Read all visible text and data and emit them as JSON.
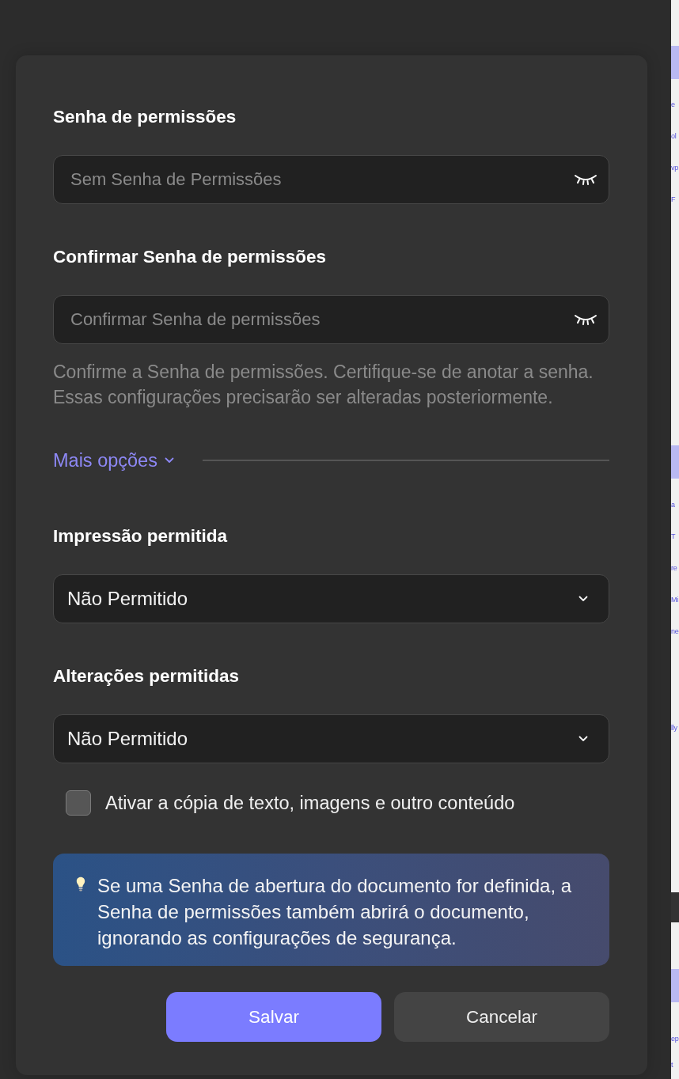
{
  "dialog": {
    "password_fields": [
      {
        "label": "Senha de permissões",
        "placeholder": "Sem Senha de Permissões",
        "masked": true
      },
      {
        "label": "Confirmar Senha de permissões",
        "placeholder": "Confirmar Senha de permissões",
        "masked": true
      }
    ],
    "hint": "Confirme a Senha de permissões. Certifique-se de anotar a senha. Essas configurações precisarão ser alteradas posteriormente.",
    "more_options": {
      "label": "Mais opções"
    },
    "dropdowns": [
      {
        "label": "Impressão permitida",
        "value": "Não Permitido"
      },
      {
        "label": "Alterações permitidas",
        "value": "Não Permitido"
      }
    ],
    "copy_option": {
      "label": "Ativar a cópia de texto, imagens e outro conteúdo",
      "checked": false
    },
    "info": "Se uma Senha de abertura do documento for definida, a Senha de permissões também abrirá o documento, ignorando as configurações de segurança.",
    "buttons": [
      {
        "label": "Salvar",
        "kind": "primary"
      },
      {
        "label": "Cancelar",
        "kind": "secondary"
      }
    ]
  },
  "background_page": {
    "sections": [
      {
        "kind": "headed",
        "lines": [
          "e",
          "ol",
          "vp",
          "F"
        ]
      },
      {
        "kind": "headed",
        "lines": [
          "a",
          "T",
          "re",
          "Mi",
          "ne"
        ]
      },
      {
        "kind": "plain",
        "lines": [
          "lly"
        ]
      },
      {
        "kind": "band"
      },
      {
        "kind": "headed",
        "lines": [
          "ep",
          "t"
        ]
      }
    ]
  }
}
